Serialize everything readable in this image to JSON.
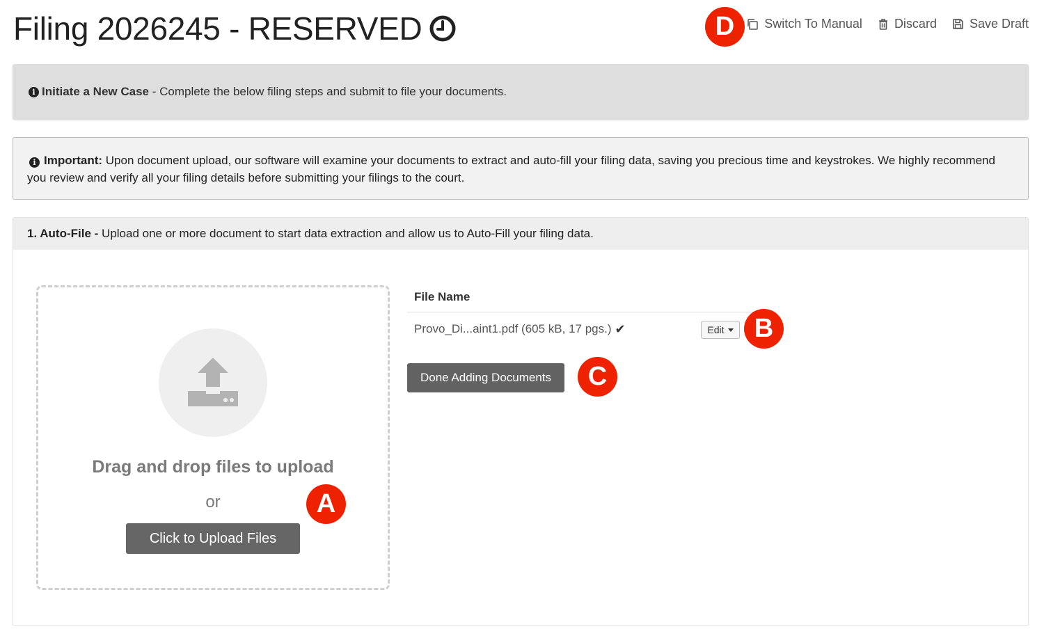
{
  "page": {
    "title": "Filing 2026245 - RESERVED",
    "title_icon": "clock-icon"
  },
  "topbar": {
    "switch_label": "Switch To Manual",
    "switch_icon": "copy-icon",
    "discard_label": "Discard",
    "discard_icon": "trash-icon",
    "save_label": "Save Draft",
    "save_icon": "floppy-disk-icon"
  },
  "info": {
    "icon": "info-icon",
    "bold": "Initiate a New Case",
    "text": " - Complete the below filing steps and submit to file your documents."
  },
  "important": {
    "bold": "Important:",
    "text": " Upon document upload, our software will examine your documents to extract and auto-fill your filing data, saving you precious time and keystrokes. We highly recommend you review and verify all your filing details before submitting your filings to the court."
  },
  "step1": {
    "bold": "1. Auto-File -",
    "text": " Upload one or more document to start data extraction and allow us to Auto-Fill your filing data.",
    "dropzone": {
      "icon": "upload-icon",
      "drag_text": "Drag and drop files to upload",
      "or_text": "or",
      "button_label": "Click to Upload Files"
    },
    "files": {
      "column_header": "File Name",
      "rows": [
        {
          "name": "Provo_Di...aint1.pdf (605 kB, 17 pgs.)",
          "status_icon": "checkmark-icon",
          "action_label": "Edit"
        }
      ]
    },
    "done_label": "Done Adding Documents"
  },
  "markers": {
    "a": "A",
    "b": "B",
    "c": "C",
    "d": "D"
  },
  "colors": {
    "marker": "#ee2200",
    "button": "#666666",
    "info_bar": "#dedede",
    "panel_head": "#eeeeee"
  }
}
